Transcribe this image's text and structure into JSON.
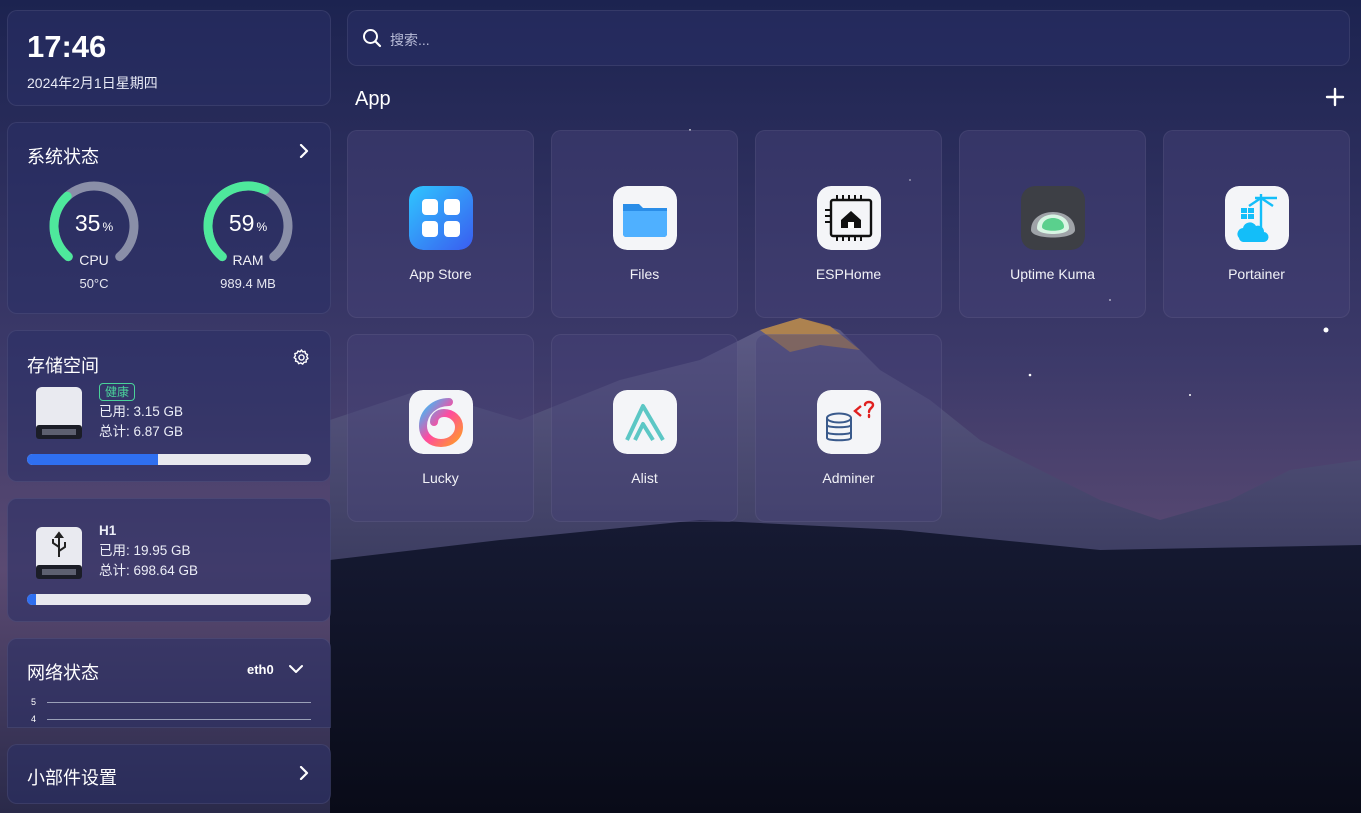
{
  "clock": {
    "time": "17:46",
    "date": "2024年2月1日星期四"
  },
  "system_status": {
    "title": "系统状态",
    "cpu": {
      "percent": "35",
      "unit": "%",
      "label": "CPU",
      "sub": "50°C",
      "value": 35
    },
    "ram": {
      "percent": "59",
      "unit": "%",
      "label": "RAM",
      "sub": "989.4 MB",
      "value": 59
    },
    "colors": {
      "accent": "#4ee89c",
      "track": "#8a8fa8"
    }
  },
  "storage": {
    "title": "存储空间",
    "disks": [
      {
        "badge": "健康",
        "used": "已用: 3.15 GB",
        "total": "总计: 6.87 GB",
        "usage_fraction": 0.46
      },
      {
        "name": "H1",
        "used": "已用: 19.95 GB",
        "total": "总计: 698.64 GB",
        "usage_fraction": 0.03
      }
    ]
  },
  "network": {
    "title": "网络状态",
    "interface": "eth0",
    "axis": [
      "5",
      "4"
    ]
  },
  "widget_settings": {
    "label": "小部件设置"
  },
  "search": {
    "placeholder": "搜索..."
  },
  "apps_section": {
    "title": "App",
    "apps": [
      {
        "label": "App Store",
        "icon": "app-store-icon"
      },
      {
        "label": "Files",
        "icon": "files-folder-icon"
      },
      {
        "label": "ESPHome",
        "icon": "esphome-chip-icon"
      },
      {
        "label": "Uptime Kuma",
        "icon": "uptime-kuma-icon"
      },
      {
        "label": "Portainer",
        "icon": "portainer-icon"
      },
      {
        "label": "Lucky",
        "icon": "lucky-icon"
      },
      {
        "label": "Alist",
        "icon": "alist-icon"
      },
      {
        "label": "Adminer",
        "icon": "adminer-database-icon"
      }
    ]
  }
}
